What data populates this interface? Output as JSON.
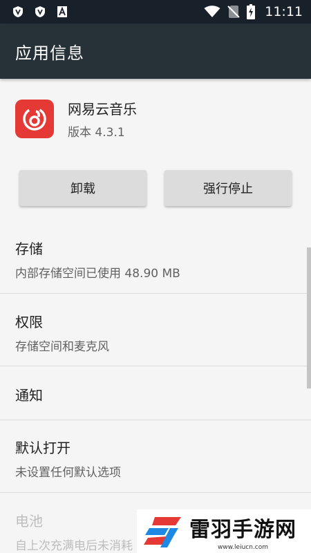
{
  "status_bar": {
    "time": "11:11",
    "icons": [
      "shield-v-icon",
      "shield-v-icon",
      "a-notification-icon",
      "wifi-icon",
      "no-sim-icon",
      "battery-charging-icon"
    ]
  },
  "app_bar": {
    "title": "应用信息"
  },
  "app": {
    "name": "网易云音乐",
    "version": "版本 4.3.1",
    "icon": "netease-music-icon",
    "icon_color": "#e53935"
  },
  "buttons": {
    "uninstall": "卸载",
    "force_stop": "强行停止"
  },
  "sections": {
    "storage": {
      "title": "存储",
      "subtitle": "内部存储空间已使用 48.90 MB"
    },
    "permissions": {
      "title": "权限",
      "subtitle": "存储空间和麦克风"
    },
    "notifications": {
      "title": "通知"
    },
    "defaults": {
      "title": "默认打开",
      "subtitle": "未设置任何默认选项"
    },
    "battery": {
      "title": "电池",
      "subtitle": "自上次充满电后未消耗"
    }
  },
  "watermark": {
    "title": "雷羽手游网",
    "url": "www.leiucn.com"
  }
}
